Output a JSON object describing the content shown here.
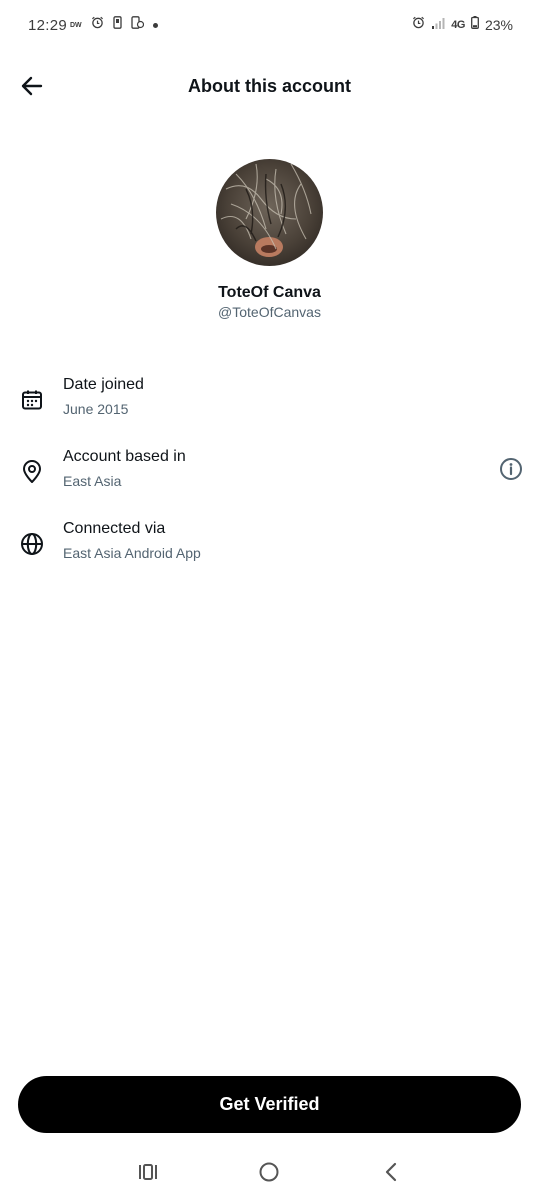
{
  "status_bar": {
    "time": "12:29",
    "carrier_tag": "DW",
    "network": "4G",
    "battery": "23%"
  },
  "header": {
    "title": "About this account"
  },
  "profile": {
    "display_name": "ToteOf Canva",
    "handle": "@ToteOfCanvas"
  },
  "info_rows": [
    {
      "icon": "calendar-icon",
      "label": "Date joined",
      "value": "June 2015"
    },
    {
      "icon": "location-pin-icon",
      "label": "Account based in",
      "value": "East Asia"
    },
    {
      "icon": "globe-icon",
      "label": "Connected via",
      "value": "East Asia Android App"
    }
  ],
  "actions": {
    "get_verified_label": "Get Verified"
  },
  "nav_bar": {
    "icons": [
      "recent-apps-icon",
      "home-icon",
      "back-icon"
    ]
  },
  "colors": {
    "text_primary": "#0f1419",
    "text_secondary": "#536471",
    "button_bg": "#000000",
    "button_text": "#ffffff"
  }
}
